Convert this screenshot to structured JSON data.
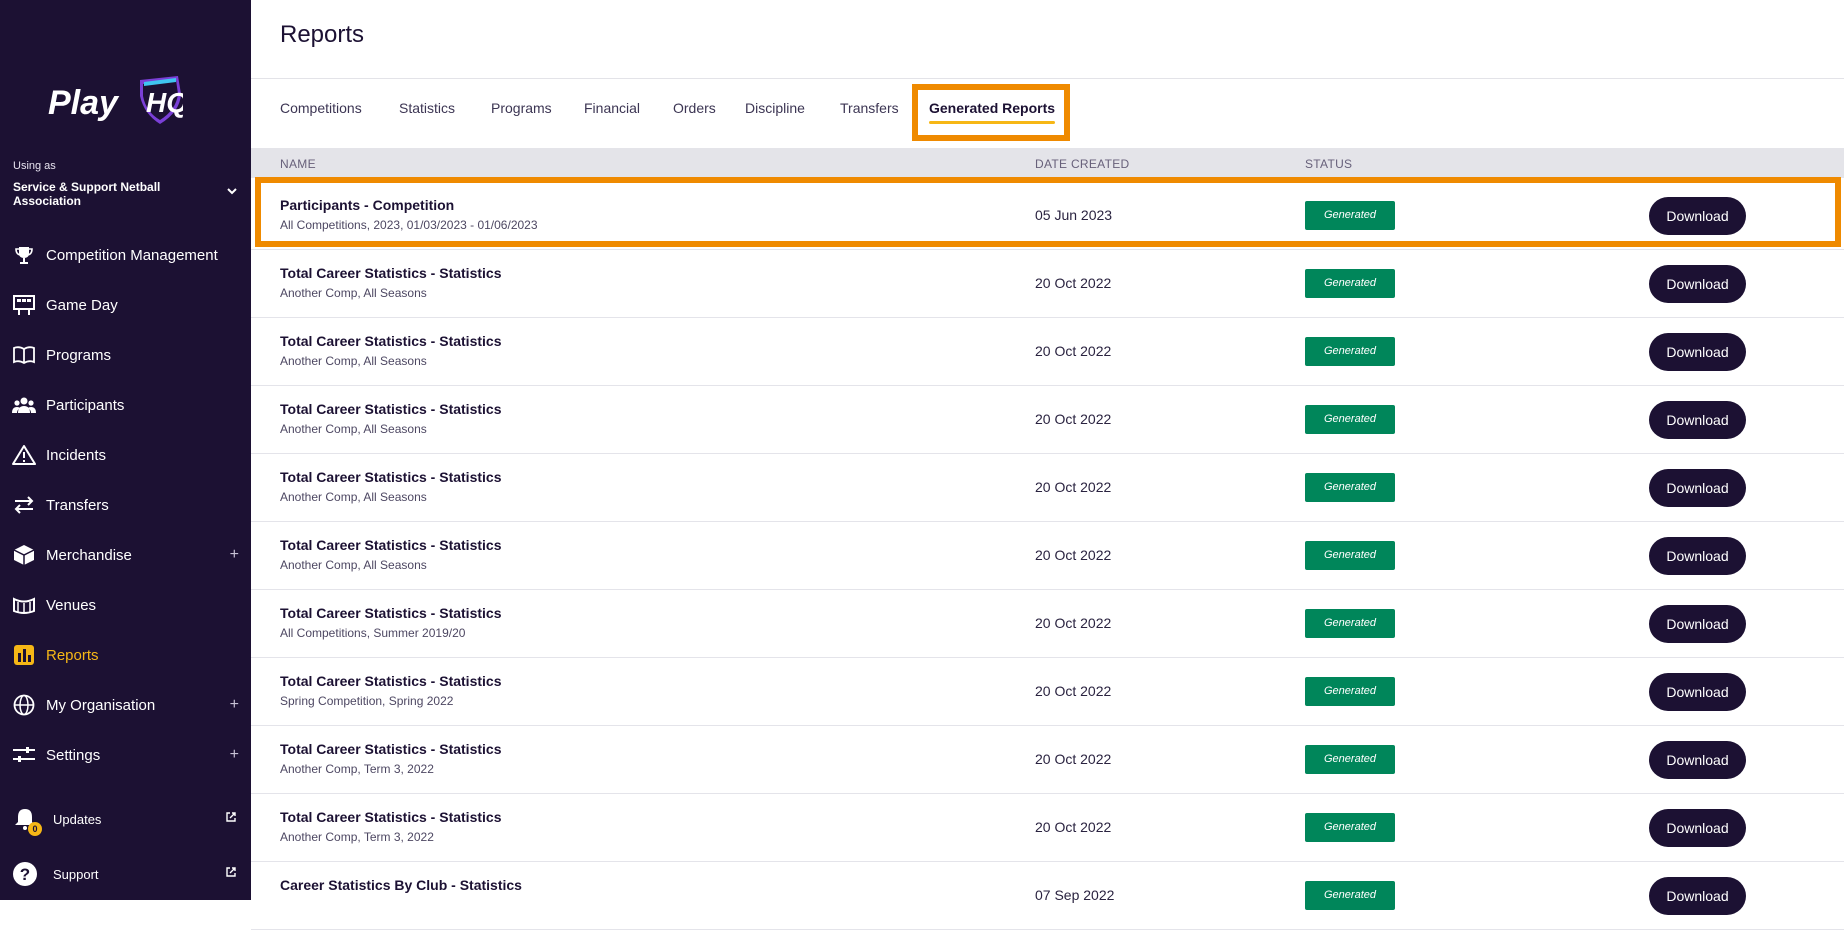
{
  "sidebar": {
    "logo_text": "PlayHQ",
    "using_as_label": "Using as",
    "org_name": "Service & Support Netball Association",
    "items": [
      {
        "label": "Competition Management",
        "icon": "trophy-icon"
      },
      {
        "label": "Game Day",
        "icon": "scoreboard-icon"
      },
      {
        "label": "Programs",
        "icon": "book-icon"
      },
      {
        "label": "Participants",
        "icon": "people-icon"
      },
      {
        "label": "Incidents",
        "icon": "warning-icon"
      },
      {
        "label": "Transfers",
        "icon": "arrows-icon"
      },
      {
        "label": "Merchandise",
        "icon": "box-icon",
        "expand": "+"
      },
      {
        "label": "Venues",
        "icon": "stadium-icon"
      },
      {
        "label": "Reports",
        "icon": "bar-chart-icon",
        "active": true
      },
      {
        "label": "My Organisation",
        "icon": "globe-icon",
        "expand": "+"
      },
      {
        "label": "Settings",
        "icon": "sliders-icon",
        "expand": "+"
      }
    ],
    "bottom": [
      {
        "label": "Updates",
        "icon": "bell-icon",
        "badge": "0"
      },
      {
        "label": "Support",
        "icon": "question-icon"
      }
    ]
  },
  "main": {
    "title": "Reports",
    "tabs": [
      {
        "label": "Competitions"
      },
      {
        "label": "Statistics"
      },
      {
        "label": "Programs"
      },
      {
        "label": "Financial"
      },
      {
        "label": "Orders"
      },
      {
        "label": "Discipline"
      },
      {
        "label": "Transfers"
      },
      {
        "label": "Generated Reports",
        "active": true
      }
    ],
    "columns": {
      "name": "NAME",
      "date": "DATE CREATED",
      "status": "STATUS"
    },
    "rows": [
      {
        "name": "Participants - Competition",
        "sub": "All Competitions, 2023, 01/03/2023 - 01/06/2023",
        "date": "05 Jun 2023",
        "status": "Generated",
        "action": "Download"
      },
      {
        "name": "Total Career Statistics - Statistics",
        "sub": "Another Comp, All Seasons",
        "date": "20 Oct 2022",
        "status": "Generated",
        "action": "Download"
      },
      {
        "name": "Total Career Statistics - Statistics",
        "sub": "Another Comp, All Seasons",
        "date": "20 Oct 2022",
        "status": "Generated",
        "action": "Download"
      },
      {
        "name": "Total Career Statistics - Statistics",
        "sub": "Another Comp, All Seasons",
        "date": "20 Oct 2022",
        "status": "Generated",
        "action": "Download"
      },
      {
        "name": "Total Career Statistics - Statistics",
        "sub": "Another Comp, All Seasons",
        "date": "20 Oct 2022",
        "status": "Generated",
        "action": "Download"
      },
      {
        "name": "Total Career Statistics - Statistics",
        "sub": "Another Comp, All Seasons",
        "date": "20 Oct 2022",
        "status": "Generated",
        "action": "Download"
      },
      {
        "name": "Total Career Statistics - Statistics",
        "sub": "All Competitions, Summer 2019/20",
        "date": "20 Oct 2022",
        "status": "Generated",
        "action": "Download"
      },
      {
        "name": "Total Career Statistics - Statistics",
        "sub": "Spring Competition, Spring 2022",
        "date": "20 Oct 2022",
        "status": "Generated",
        "action": "Download"
      },
      {
        "name": "Total Career Statistics - Statistics",
        "sub": "Another Comp, Term 3, 2022",
        "date": "20 Oct 2022",
        "status": "Generated",
        "action": "Download"
      },
      {
        "name": "Total Career Statistics - Statistics",
        "sub": "Another Comp, Term 3, 2022",
        "date": "20 Oct 2022",
        "status": "Generated",
        "action": "Download"
      },
      {
        "name": "Career Statistics By Club - Statistics",
        "sub": "",
        "date": "07 Sep 2022",
        "status": "Generated",
        "action": "Download"
      }
    ]
  },
  "colors": {
    "sidebar_bg": "#1c1133",
    "accent_yellow": "#f6b716",
    "highlight_orange": "#ef8a00",
    "status_green": "#00865a",
    "button_dark": "#1c1133"
  }
}
